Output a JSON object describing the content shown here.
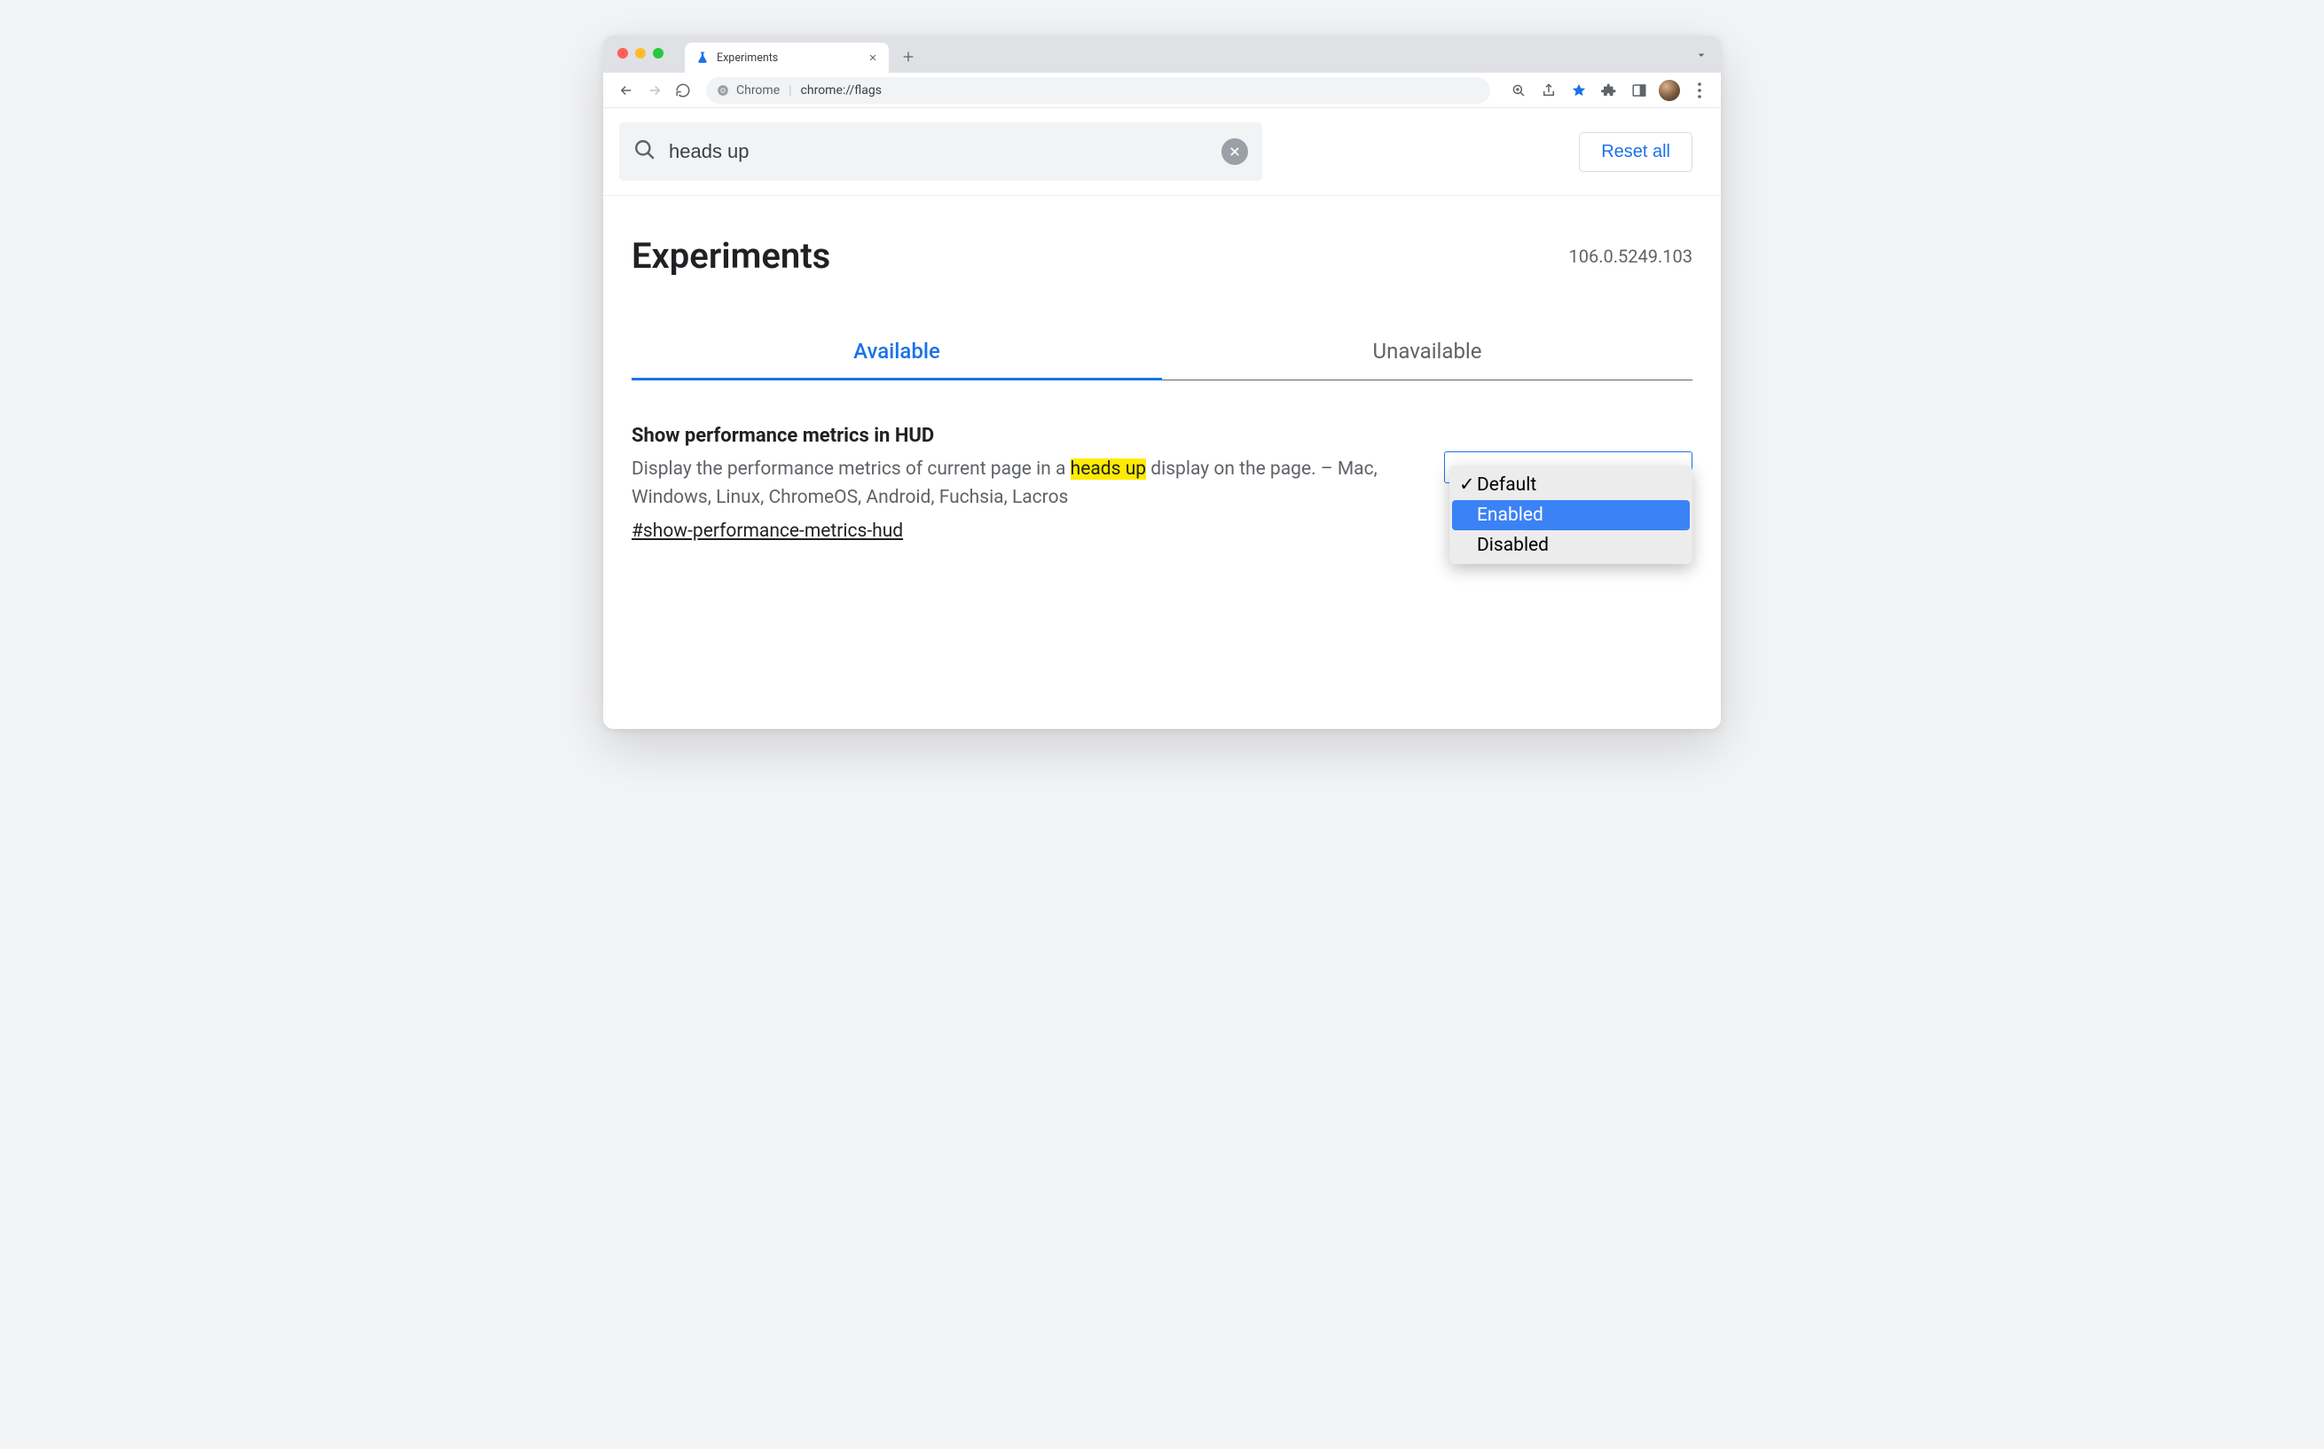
{
  "browser": {
    "tab_title": "Experiments",
    "omnibox_prefix": "Chrome",
    "omnibox_url": "chrome://flags"
  },
  "search": {
    "query": "heads up",
    "reset_label": "Reset all"
  },
  "header": {
    "title": "Experiments",
    "version": "106.0.5249.103"
  },
  "tabs": {
    "available": "Available",
    "unavailable": "Unavailable"
  },
  "experiment": {
    "title": "Show performance metrics in HUD",
    "desc_before": "Display the performance metrics of current page in a ",
    "desc_highlight": "heads up",
    "desc_after": " display on the page. – Mac, Windows, Linux, ChromeOS, Android, Fuchsia, Lacros",
    "hash": "#show-performance-metrics-hud",
    "options": {
      "default": "Default",
      "enabled": "Enabled",
      "disabled": "Disabled"
    },
    "checkmark": "✓"
  }
}
